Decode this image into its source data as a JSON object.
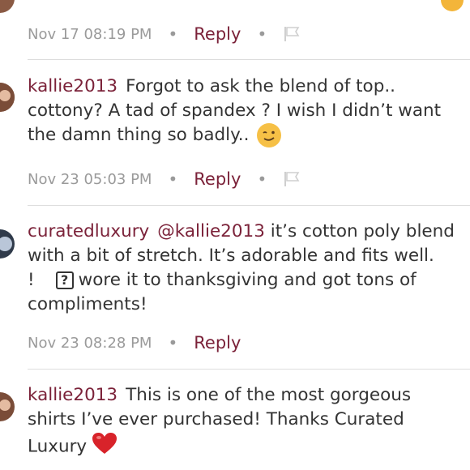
{
  "comments": [
    {
      "timestamp": "Nov 17 08:19 PM",
      "reply_label": "Reply"
    },
    {
      "username": "kallie2013",
      "text_line1": "Forgot to ask the blend of top..",
      "text_line2": "cottony? A tad of spandex ? I wish I didn’t want",
      "text_line3": "the damn thing so badly..",
      "timestamp": "Nov 23 05:03 PM",
      "reply_label": "Reply"
    },
    {
      "username": "curatedluxury",
      "mention": "@kallie2013",
      "text_line1_rest": "it’s cotton poly blend",
      "text_line2": "with a bit of stretch. It’s adorable and fits well.",
      "text_line3_start": "!",
      "text_line3_box": "?",
      "text_line3_rest": "wore it to thanksgiving and got tons of",
      "text_line4": "compliments!",
      "timestamp": "Nov 23 08:28 PM",
      "reply_label": "Reply"
    },
    {
      "username": "kallie2013",
      "text_line1": "This is one of the most gorgeous",
      "text_line2": "shirts I’ve ever purchased!  Thanks Curated",
      "text_line3": "Luxury"
    }
  ],
  "colors": {
    "accent": "#7b2239",
    "text": "#333333",
    "meta": "#9a9a9a"
  }
}
